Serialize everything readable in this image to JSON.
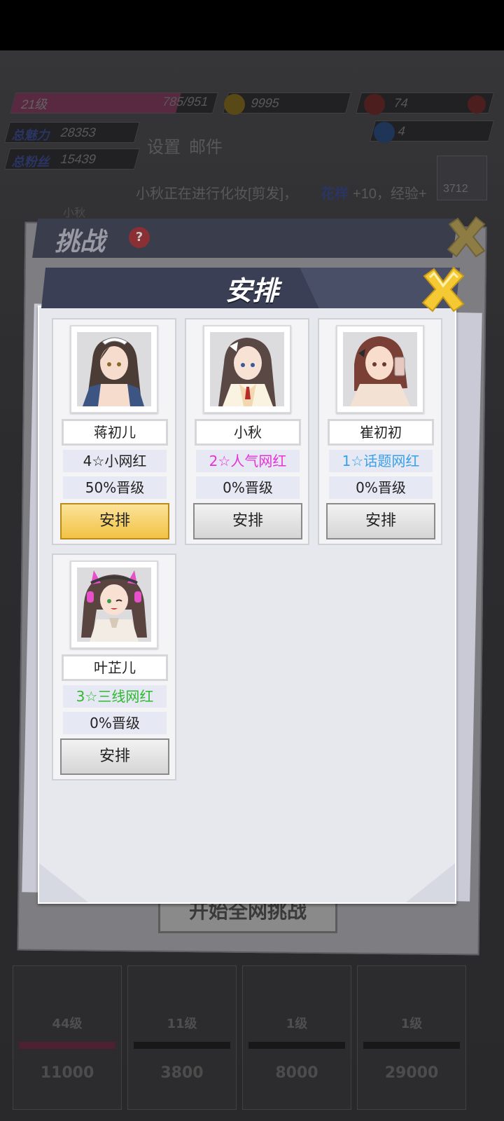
{
  "hud": {
    "level": "21级",
    "exp": "785/951",
    "exp_progress": 0.82,
    "coins": "9995",
    "roses": "74",
    "diamonds": "4",
    "charm_label": "总魅力",
    "charm_value": "28353",
    "fans_label": "总粉丝",
    "fans_value": "15439",
    "settings": "设置",
    "mail": "邮件",
    "rank_score": "3712",
    "message": "小秋正在进行化妆[剪发]，",
    "message_stat": "花样",
    "message_tail": "+10，经验+"
  },
  "challenge": {
    "title": "挑战",
    "help": "?",
    "start_button": "开始全网挑战",
    "partial_name": "小秋"
  },
  "bottom_characters": [
    {
      "level": "44级",
      "cost": "11000"
    },
    {
      "level": "11级",
      "cost": "3800"
    },
    {
      "level": "1级",
      "cost": "8000"
    },
    {
      "level": "1级",
      "cost": "29000"
    }
  ],
  "dialog": {
    "title": "安排",
    "cards": [
      {
        "name": "蒋初儿",
        "rank": "4☆小网红",
        "rank_color": "#222222",
        "promotion": "50%晋级",
        "button": "安排",
        "selected": true
      },
      {
        "name": "小秋",
        "rank": "2☆人气网红",
        "rank_color": "#e632d8",
        "promotion": "0%晋级",
        "button": "安排",
        "selected": false
      },
      {
        "name": "崔初初",
        "rank": "1☆话题网红",
        "rank_color": "#3aa0e8",
        "promotion": "0%晋级",
        "button": "安排",
        "selected": false
      },
      {
        "name": "叶芷儿",
        "rank": "3☆三线网红",
        "rank_color": "#2fb830",
        "promotion": "0%晋级",
        "button": "安排",
        "selected": false
      }
    ]
  },
  "colors": {
    "header_bg": "#3b3f55",
    "close_yellow": "#f5c934",
    "button_active": "#f2c243"
  }
}
